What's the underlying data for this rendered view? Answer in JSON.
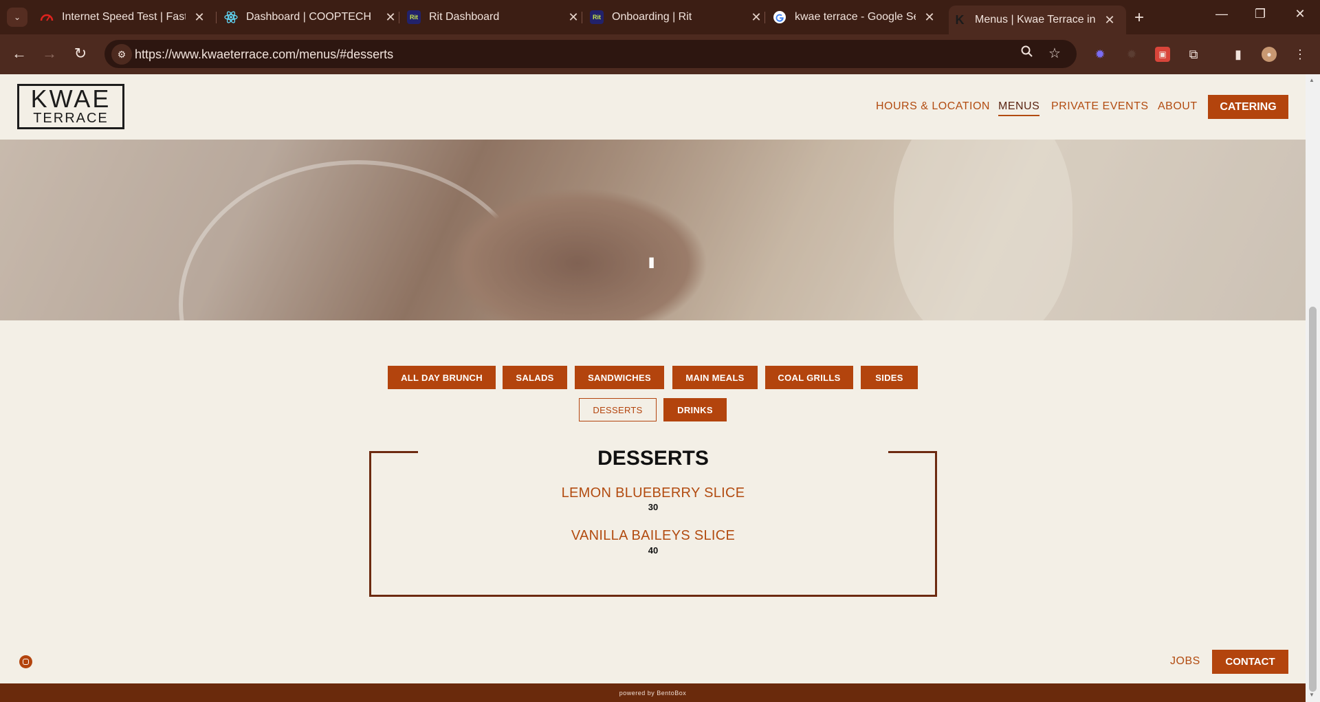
{
  "browser": {
    "tabs": [
      {
        "title": "Internet Speed Test | Fast.com",
        "icon": "fast-speedometer-icon"
      },
      {
        "title": "Dashboard | COOPTECH",
        "icon": "react-atom-icon"
      },
      {
        "title": "Rit Dashboard",
        "icon": "rit-icon"
      },
      {
        "title": "Onboarding | Rit",
        "icon": "rit-icon"
      },
      {
        "title": "kwae terrace - Google Search",
        "icon": "google-g-icon"
      },
      {
        "title": "Menus | Kwae Terrace in Accra",
        "icon": "kwae-k-icon"
      }
    ],
    "url": "https://www.kwaeterrace.com/menus/#desserts",
    "fav_rit": "Rit"
  },
  "site": {
    "logo_line1": "KWAE",
    "logo_line2": "TERRACE",
    "nav": {
      "hours": "HOURS & LOCATION",
      "menus": "MENUS",
      "private": "PRIVATE EVENTS",
      "about": "ABOUT",
      "catering": "CATERING"
    },
    "pause_glyph": "II",
    "categories": [
      "ALL DAY BRUNCH",
      "SALADS",
      "SANDWICHES",
      "MAIN MEALS",
      "COAL GRILLS",
      "SIDES",
      "DESSERTS",
      "DRINKS"
    ],
    "menu": {
      "title": "DESSERTS",
      "items": [
        {
          "name": "LEMON BLUEBERRY SLICE",
          "price": "30"
        },
        {
          "name": "VANILLA BAILEYS SLICE",
          "price": "40"
        }
      ]
    },
    "footer": {
      "jobs": "JOBS",
      "contact": "CONTACT",
      "powered": "powered by BentoBox"
    },
    "accent_color": "#b3440d",
    "dark_accent_color": "#6a2a0c"
  }
}
